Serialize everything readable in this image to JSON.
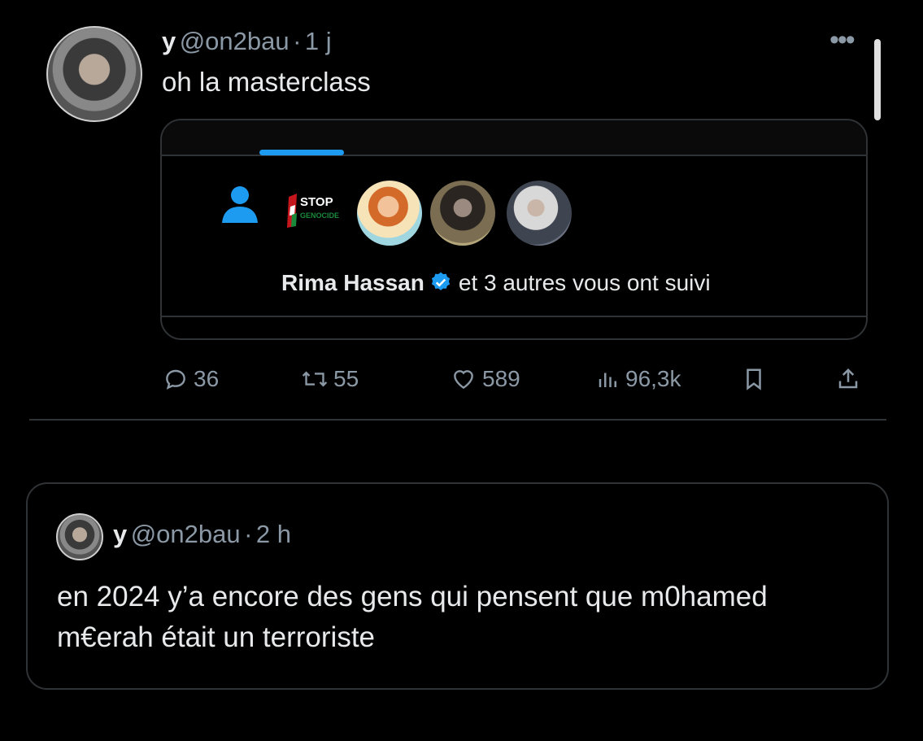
{
  "tweet": {
    "display_name": "y",
    "handle": "@on2bau",
    "separator": "·",
    "time": "1 j",
    "text": "oh la masterclass",
    "more_icon": "more-horizontal-icon",
    "card": {
      "stop_badge_line1": "STOP",
      "stop_badge_line2": "GENOCIDE",
      "follower_name": "Rima Hassan",
      "follow_text": "et 3 autres vous ont suivi"
    },
    "actions": {
      "replies": "36",
      "reposts": "55",
      "likes": "589",
      "views": "96,3k"
    }
  },
  "quote": {
    "display_name": "y",
    "handle": "@on2bau",
    "separator": "·",
    "time": "2 h",
    "text": "en 2024 y’a encore des gens qui pensent que m0hamed m€erah était un terroriste"
  },
  "colors": {
    "background": "#000000",
    "text": "#e7e9ea",
    "muted": "#8b98a5",
    "border": "#2f3336",
    "accent": "#1d9bf0"
  }
}
